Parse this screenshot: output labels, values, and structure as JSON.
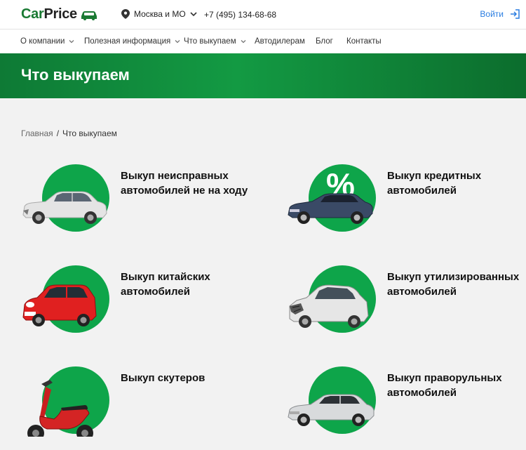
{
  "header": {
    "logo_part1": "Car",
    "logo_part2": "Price",
    "city": "Москва и МО",
    "phone": "+7 (495) 134-68-68",
    "login_label": "Войти"
  },
  "nav": {
    "items": [
      {
        "label": "О компании"
      },
      {
        "label": "Полезная информация"
      },
      {
        "label": "Что выкупаем"
      },
      {
        "label": "Автодилерам"
      },
      {
        "label": "Блог"
      },
      {
        "label": "Контакты"
      }
    ]
  },
  "banner": {
    "title": "Что выкупаем"
  },
  "breadcrumb": {
    "home": "Главная",
    "separator": "/",
    "current": "Что выкупаем"
  },
  "categories": [
    {
      "title": "Выкуп неисправных автомобилей не на ходу",
      "image": "damaged-sedan"
    },
    {
      "title": "Выкуп кредитных автомобилей",
      "image": "percent-sedan",
      "badge": "%"
    },
    {
      "title": "Выкуп китайских автомобилей",
      "image": "red-hatchback"
    },
    {
      "title": "Выкуп утилизированных автомобилей",
      "image": "wrecked-car"
    },
    {
      "title": "Выкуп скутеров",
      "image": "scooter"
    },
    {
      "title": "Выкуп праворульных автомобилей",
      "image": "silver-sedan"
    }
  ],
  "colors": {
    "brand_green": "#139a43",
    "link_blue": "#2a7de1",
    "circle_green": "#0ea54a"
  }
}
